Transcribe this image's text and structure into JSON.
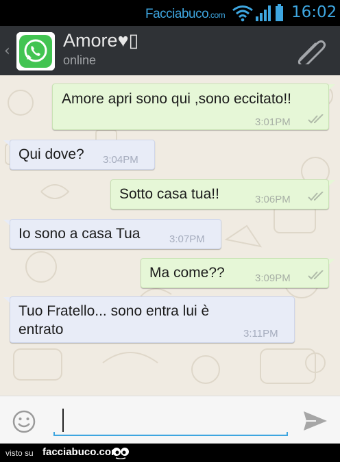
{
  "status_bar": {
    "watermark_site": "Facciabuco",
    "watermark_tld": ".com",
    "clock": "16:02",
    "icons": [
      "wifi-icon",
      "signal-icon",
      "battery-icon"
    ],
    "accent_color": "#3ea6e0"
  },
  "header": {
    "back_icon": "chevron-left-icon",
    "contact_name": "Amore♥▯",
    "contact_status": "online",
    "attach_icon": "paperclip-icon"
  },
  "messages": [
    {
      "direction": "out",
      "text": "Amore apri sono qui ,sono eccitato!!",
      "time": "3:01PM",
      "ticks": "double"
    },
    {
      "direction": "in",
      "text": "Qui dove?",
      "time": "3:04PM"
    },
    {
      "direction": "out",
      "text": "Sotto casa tua!!",
      "time": "3:06PM",
      "ticks": "double"
    },
    {
      "direction": "in",
      "text": "Io sono a casa Tua",
      "time": "3:07PM"
    },
    {
      "direction": "out",
      "text": "Ma come??",
      "time": "3:09PM",
      "ticks": "double"
    },
    {
      "direction": "in",
      "text_line1": "Tuo Fratello... sono entra lui è",
      "text_line2": "entrato",
      "time": "3:11PM"
    }
  ],
  "input_bar": {
    "value": "",
    "emoji_icon": "smiley-icon",
    "send_icon": "send-icon"
  },
  "footer": {
    "visto": "visto su",
    "site": "facciabuco.com"
  },
  "colors": {
    "outgoing_bubble": "#e6f7d7",
    "incoming_bubble": "#e8ecf7",
    "header_bg": "#2f3236",
    "chat_bg": "#f0ebe2"
  }
}
